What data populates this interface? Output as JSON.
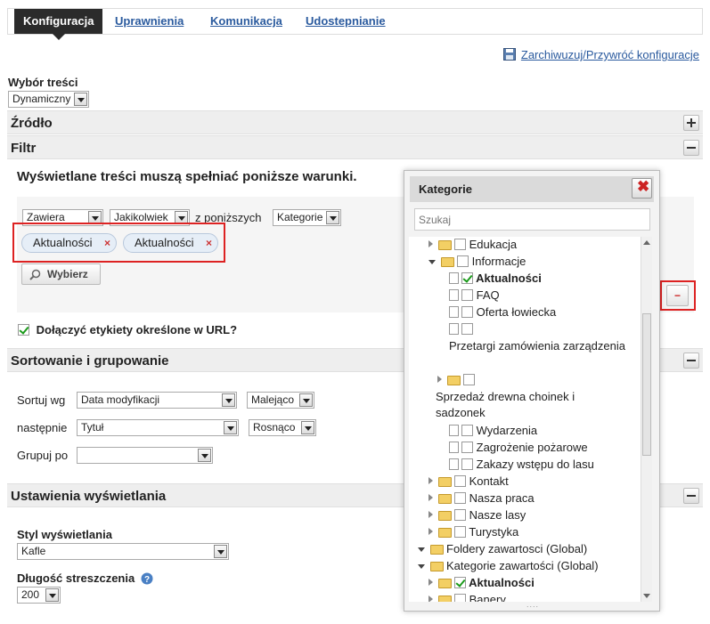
{
  "tabs": [
    "Konfiguracja",
    "Uprawnienia",
    "Komunikacja",
    "Udostepnianie"
  ],
  "archive_link": "Zarchiwuzuj/Przywróć konfiguracje",
  "content_choice": {
    "label": "Wybór treści",
    "value": "Dynamiczny"
  },
  "sections": {
    "source": "Źródło",
    "filter": "Filtr",
    "sort": "Sortowanie i grupowanie",
    "display": "Ustawienia wyświetlania"
  },
  "filter": {
    "heading": "Wyświetlane treści muszą spełniać poniższe warunki.",
    "cond1": "Zawiera",
    "cond2": "Jakikolwiek",
    "between": "z poniższych",
    "cond3": "Kategorie",
    "tags": [
      "Aktualności",
      "Aktualności"
    ],
    "remove_glyph": "×",
    "select_button": "Wybierz",
    "include_url_tags": "Dołączyć etykiety określone w URL?"
  },
  "sort": {
    "sort_by_label": "Sortuj wg",
    "sort_by": "Data modyfikacji",
    "sort_dir": "Malejąco",
    "then_label": "następnie",
    "then_by": "Tytuł",
    "then_dir": "Rosnąco",
    "group_label": "Grupuj po",
    "group_by": ""
  },
  "display": {
    "style_label": "Styl wyświetlania",
    "style": "Kafle",
    "abstract_label": "Długość streszczenia",
    "abstract_len": "200"
  },
  "minus_glyph": "−",
  "dialog": {
    "title": "Kategorie",
    "close_glyph": "✖",
    "search_placeholder": "Szukaj",
    "tree": {
      "edukacja": "Edukacja",
      "informacje": "Informacje",
      "aktualnosci": "Aktualności",
      "faq": "FAQ",
      "oferta": "Oferta łowiecka",
      "przetargi": "Przetargi zamówienia zarządzenia",
      "sprzedaz": "Sprzedaż drewna choinek i sadzonek",
      "wydarzenia": "Wydarzenia",
      "zagrozenie": "Zagrożenie pożarowe",
      "zakazy": "Zakazy wstępu do lasu",
      "kontakt": "Kontakt",
      "nasza_praca": "Nasza praca",
      "nasze_lasy": "Nasze lasy",
      "turystyka": "Turystyka",
      "foldery": "Foldery zawartosci (Global)",
      "kategorie": "Kategorie zawartości (Global)",
      "aktualnosci2": "Aktualności",
      "banery": "Banery"
    }
  },
  "colors": {
    "accent": "#2a5a9e",
    "active_tab": "#2b2b2b",
    "highlight": "#dd2222",
    "check": "#1a9a1a"
  }
}
